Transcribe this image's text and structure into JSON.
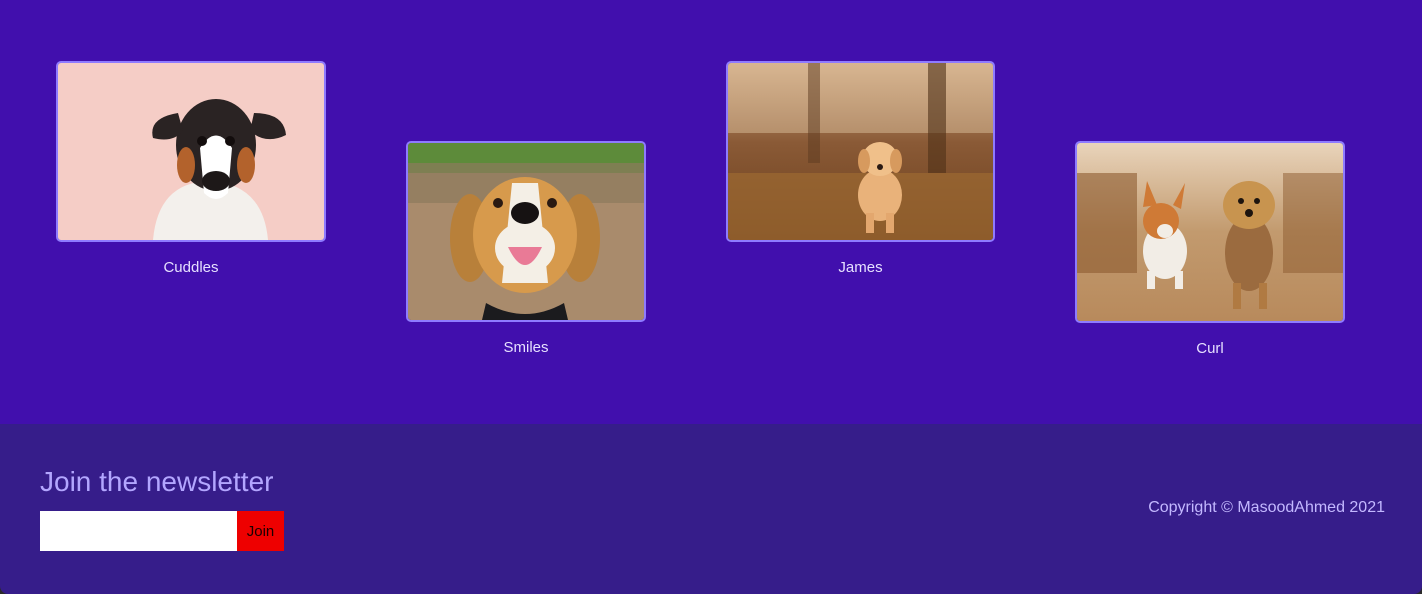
{
  "gallery": {
    "dogs": [
      {
        "name": "Cuddles"
      },
      {
        "name": "Smiles"
      },
      {
        "name": "James"
      },
      {
        "name": "Curl"
      }
    ]
  },
  "newsletter": {
    "title": "Join the newsletter",
    "input_value": "",
    "button_label": "Join"
  },
  "footer": {
    "copyright": "Copyright © MasoodAhmed 2021"
  },
  "colors": {
    "gallery_background": "#410fad",
    "footer_background": "#361d8a",
    "card_border": "#8e7bff",
    "join_button": "#ee0000"
  }
}
